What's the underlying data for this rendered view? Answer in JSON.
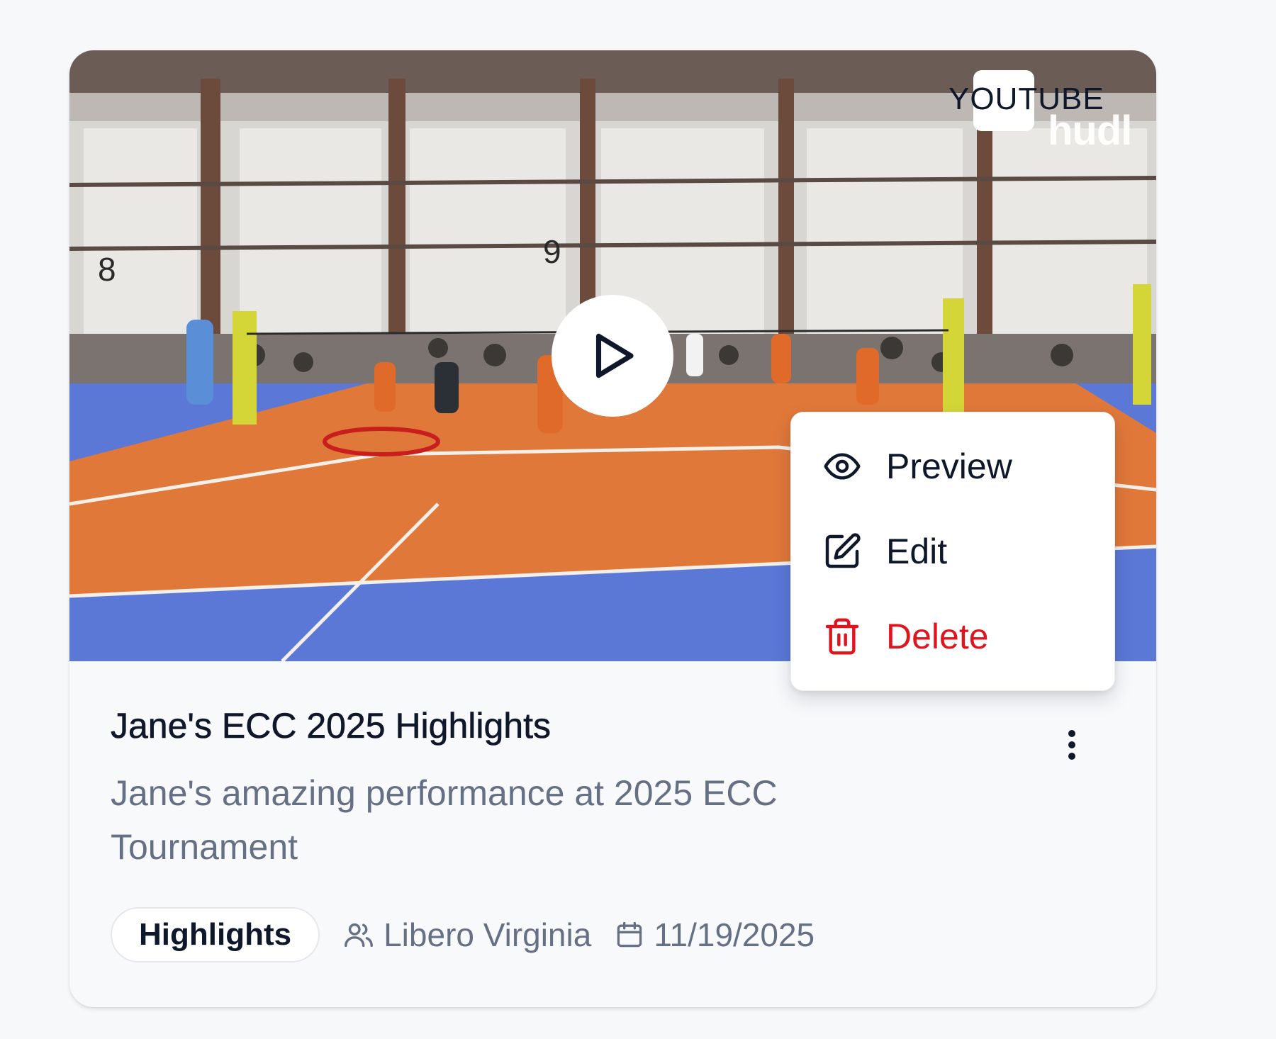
{
  "card": {
    "platform_badge": "YOUTUBE",
    "watermark": "hudl",
    "title": "Jane's ECC 2025 Highlights",
    "description": "Jane's amazing performance at 2025 ECC Tournament",
    "category": "Highlights",
    "team": "Libero Virginia",
    "date": "11/19/2025",
    "court_numbers": [
      "8",
      "9"
    ]
  },
  "menu": {
    "items": [
      {
        "label": "Preview",
        "icon": "eye-icon"
      },
      {
        "label": "Edit",
        "icon": "edit-icon"
      },
      {
        "label": "Delete",
        "icon": "trash-icon",
        "color": "#e0141e"
      }
    ]
  },
  "colors": {
    "text_primary": "#0f172a",
    "text_secondary": "#667085",
    "danger": "#e0141e",
    "court_orange": "#e0783a",
    "court_blue": "#5b78d6"
  }
}
